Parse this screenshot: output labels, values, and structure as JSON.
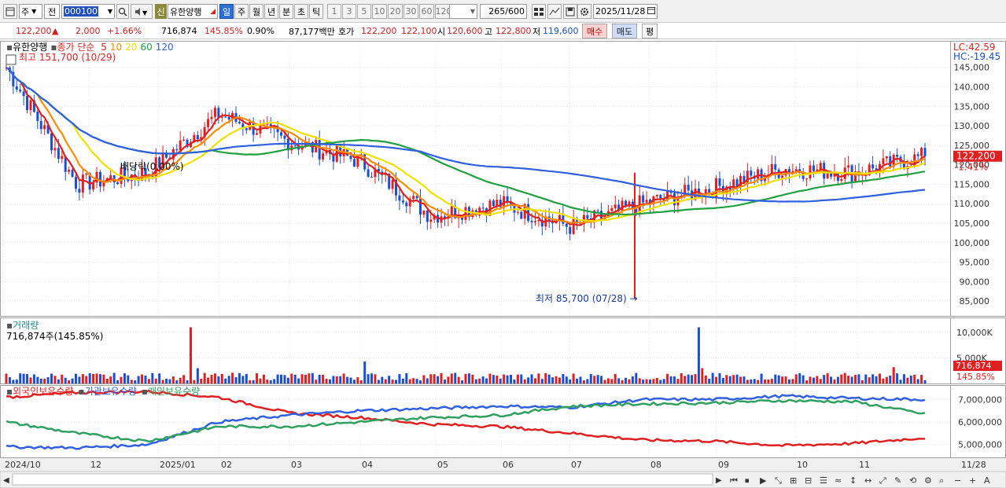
{
  "toolbar1": {
    "market_select": "주",
    "prev_label": "전",
    "code_value": "000100",
    "stock_name": "유한양행",
    "badge_credit": "신",
    "periods": [
      "일",
      "주",
      "월",
      "년",
      "분",
      "초",
      "틱"
    ],
    "selected_period": "일",
    "intervals": [
      "1",
      "3",
      "5",
      "10",
      "20",
      "30",
      "60",
      "120"
    ],
    "count_value": "265",
    "count_max": "/600",
    "date_value": "2025/11/28"
  },
  "toolbar2": {
    "price": "122,200",
    "change_arrow": "▲",
    "change": "2,000",
    "change_pct": "+1.66%",
    "volume": "716,874",
    "volume_ratio": "145.85%",
    "turnover": "0.90%",
    "amount": "87,177백만",
    "quote_label": "호가",
    "ask": "122,200",
    "bid": "122,100",
    "open_label": "시",
    "open": "120,600",
    "high_label": "고",
    "high": "122,800",
    "low_label": "저",
    "low": "119,600",
    "buy_button": "매수",
    "sell_button": "매도",
    "eval_button": "평"
  },
  "price_panel": {
    "title": "유한양행",
    "ma_label": "종가 단순",
    "ma_periods": [
      "5",
      "10",
      "20",
      "60",
      "120"
    ],
    "ma_colors": [
      "#e02020",
      "#ff8c00",
      "#f0e000",
      "#20a040",
      "#3060e0"
    ],
    "high_note": "최고 151,700 (10/29)",
    "low_note": "최저 85,700 (07/28)",
    "dividend_note": "배당락(0.00%)",
    "lc": "LC:42.59",
    "hc": "HC:-19.45",
    "last_price_tag": "122,200",
    "last_pct_tag": "1.41%"
  },
  "volume_panel": {
    "title": "거래량",
    "summary": "716,874주(145.85%)",
    "last_tag": "716,874",
    "last_pct_tag": "145.85%",
    "axis_labels": [
      "10,000K",
      "5,000K"
    ]
  },
  "holdings_panel": {
    "series_names": [
      "외국인보유수량",
      "기관보유수량",
      "개인보유수량"
    ],
    "series_colors": [
      "#e02020",
      "#3060e0",
      "#30a060"
    ],
    "axis_labels": [
      "7,000,000",
      "6,000,000",
      "5,000,000"
    ]
  },
  "x_axis": {
    "labels": [
      "2024/10",
      "12",
      "2025/01",
      "02",
      "03",
      "04",
      "05",
      "06",
      "07",
      "08",
      "09",
      "10",
      "11"
    ],
    "right_label": "11/28"
  },
  "chart_data": {
    "type": "candlestick",
    "y_axis": [
      "145,000",
      "140,000",
      "135,000",
      "130,000",
      "125,000",
      "120,000",
      "115,000",
      "110,000",
      "105,000",
      "100,000",
      "95,000",
      "90,000",
      "85,000"
    ],
    "ylim": [
      82000,
      151000
    ],
    "month_closes": [
      {
        "month": "2024/10",
        "value": 145000
      },
      {
        "month": "2024/11",
        "value": 115000
      },
      {
        "month": "2024/12",
        "value": 118000
      },
      {
        "month": "2025/01",
        "value": 133000
      },
      {
        "month": "2025/02",
        "value": 126000
      },
      {
        "month": "2025/03",
        "value": 121000
      },
      {
        "month": "2025/04",
        "value": 107000
      },
      {
        "month": "2025/05",
        "value": 110000
      },
      {
        "month": "2025/06",
        "value": 104000
      },
      {
        "month": "2025/07",
        "value": 110000
      },
      {
        "month": "2025/08",
        "value": 114000
      },
      {
        "month": "2025/09",
        "value": 119000
      },
      {
        "month": "2025/10",
        "value": 118000
      },
      {
        "month": "2025/11",
        "value": 122200
      }
    ],
    "volume_max": 12000
  }
}
